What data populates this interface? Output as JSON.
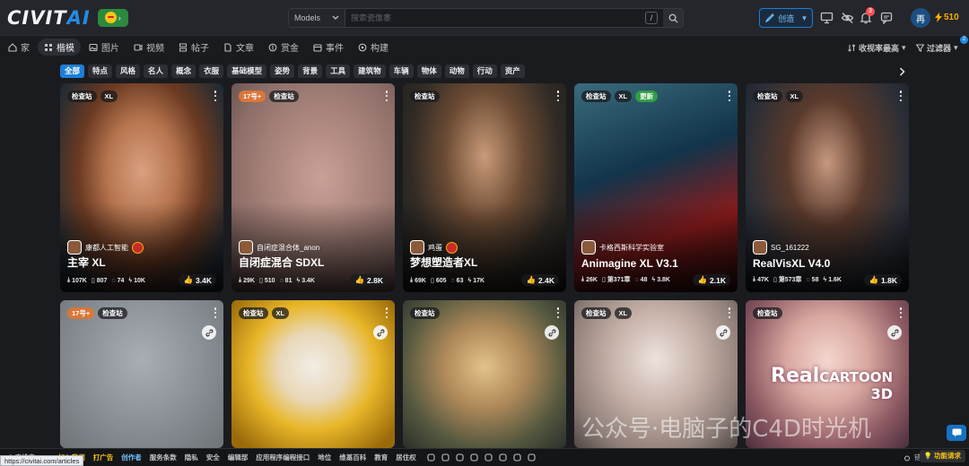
{
  "app": {
    "logo_a": "CIVIT",
    "logo_b": "AI"
  },
  "search": {
    "scope": "Models",
    "placeholder": "搜索瓷像寨",
    "shortcut": "/"
  },
  "header": {
    "create_label": "创造",
    "notifications_count": "3",
    "avatar_initial": "再",
    "buzz_amount": "510"
  },
  "nav": {
    "tabs": [
      {
        "label": "家",
        "icon": "home-icon"
      },
      {
        "label": "楷模",
        "icon": "models-icon",
        "active": true
      },
      {
        "label": "图片",
        "icon": "image-icon"
      },
      {
        "label": "视频",
        "icon": "video-icon"
      },
      {
        "label": "帖子",
        "icon": "posts-icon"
      },
      {
        "label": "文章",
        "icon": "article-icon"
      },
      {
        "label": "赏金",
        "icon": "bounty-icon"
      },
      {
        "label": "事件",
        "icon": "event-icon"
      },
      {
        "label": "构建",
        "icon": "build-icon"
      }
    ],
    "sort_label": "收视率最高",
    "filter_label": "过滤器",
    "filter_count": "2"
  },
  "chips": [
    "全部",
    "特点",
    "风格",
    "名人",
    "概念",
    "衣服",
    "基础模型",
    "姿势",
    "背景",
    "工具",
    "建筑物",
    "车辆",
    "物体",
    "动物",
    "行动",
    "资产"
  ],
  "cards": [
    {
      "tags": [
        "检查站",
        "XL"
      ],
      "creator": "康都人工智能",
      "title": "主宰 XL",
      "stats": [
        "107K",
        "807",
        "74",
        "10K"
      ],
      "likes": "3.4K"
    },
    {
      "tags": [
        "17号+",
        "检查站"
      ],
      "creator": "自闭症混合体_anon",
      "title": "自闭症混合 SDXL",
      "stats": [
        "29K",
        "510",
        "81",
        "3.4K"
      ],
      "likes": "2.8K"
    },
    {
      "tags": [
        "检查站"
      ],
      "creator": "鸡蛋",
      "title": "梦想塑造者XL",
      "stats": [
        "69K",
        "605",
        "63",
        "17K"
      ],
      "likes": "2.4K"
    },
    {
      "tags": [
        "检查站",
        "XL",
        "更新"
      ],
      "creator": "卡格西斯科学实验室",
      "title": "Animagine XL V3.1",
      "stats": [
        "26K",
        "第371章",
        "48",
        "3.8K"
      ],
      "likes": "2.1K"
    },
    {
      "tags": [
        "检查站",
        "XL"
      ],
      "creator": "SG_161222",
      "title": "RealVisXL V4.0",
      "stats": [
        "47K",
        "第573章",
        "58",
        "1.6K"
      ],
      "likes": "1.8K"
    },
    {
      "tags": [
        "17号+",
        "检查站"
      ]
    },
    {
      "tags": [
        "检查站",
        "XL"
      ]
    },
    {
      "tags": [
        "检查站"
      ]
    },
    {
      "tags": [
        "检查站",
        "XL"
      ]
    },
    {
      "tags": [
        "检查站"
      ],
      "overlay_a": "Real",
      "overlay_b": "CARTOON",
      "overlay_c": "3D"
    }
  ],
  "footer": {
    "copyright": "© 奇维泰2024",
    "links": [
      "加入我们",
      "打广告",
      "创作者",
      "服务条款",
      "隐私",
      "安全",
      "编辑部",
      "应用程序编程接口",
      "地位",
      "维基百科",
      "教育",
      "居住权"
    ],
    "support": "错误",
    "feature_label": "功能请求",
    "status_url": "https://civitai.com/articles"
  },
  "watermark": "公众号·电脑子的C4D时光机",
  "colors": {
    "accent": "#228be6",
    "background": "#1a1b1e",
    "surface": "#25262b",
    "buzz": "#fab005"
  }
}
